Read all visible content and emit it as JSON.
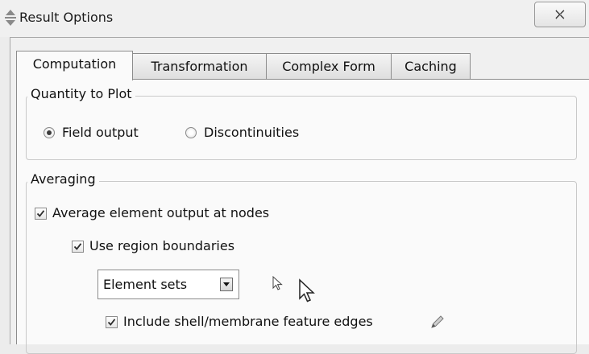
{
  "window": {
    "title": "Result Options",
    "icon": "move-arrows-icon",
    "close_icon": "close-x-icon"
  },
  "tabs": [
    {
      "label": "Computation",
      "active": true
    },
    {
      "label": "Transformation",
      "active": false
    },
    {
      "label": "Complex Form",
      "active": false
    },
    {
      "label": "Caching",
      "active": false
    }
  ],
  "quantity_to_plot": {
    "legend": "Quantity to Plot",
    "options": [
      {
        "label": "Field output",
        "selected": true
      },
      {
        "label": "Discontinuities",
        "selected": false
      }
    ]
  },
  "averaging": {
    "legend": "Averaging",
    "average_nodes": {
      "label": "Average element output at nodes",
      "checked": true
    },
    "use_region_boundaries": {
      "label": "Use region boundaries",
      "checked": true
    },
    "region_type": {
      "value": "Element sets"
    },
    "include_shell_edges": {
      "label": "Include shell/membrane feature edges",
      "checked": true
    }
  },
  "icons": [
    "move-arrows-icon",
    "close-x-icon",
    "mouse-pointer-icon",
    "mouse-cursor-icon",
    "pencil-icon"
  ]
}
